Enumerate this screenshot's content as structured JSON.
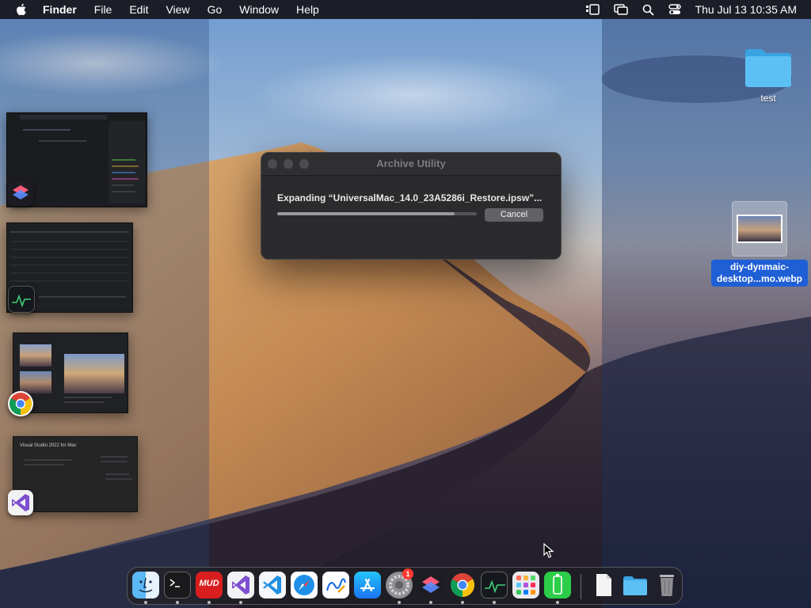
{
  "menubar": {
    "app_name": "Finder",
    "items": [
      "File",
      "Edit",
      "View",
      "Go",
      "Window",
      "Help"
    ],
    "clock": "Thu Jul 13  10:35 AM"
  },
  "dialog": {
    "title": "Archive Utility",
    "message": "Expanding “UniversalMac_14.0_23A5286i_Restore.ipsw”...",
    "progress_percent": 89,
    "cancel_label": "Cancel"
  },
  "desktop": {
    "folder_label": "test",
    "file_label_line1": "diy-dynmaic-",
    "file_label_line2": "desktop...mo.webp"
  },
  "stage_manager": {
    "apps": [
      "shortcuts-icon",
      "activity-monitor-icon",
      "chrome-icon",
      "visual-studio-icon"
    ],
    "vs_thumb_title": "Visual Studio 2022 for Mac"
  },
  "dock": {
    "apps": [
      "finder-icon",
      "terminal-icon",
      "mud-icon",
      "visual-studio-icon",
      "vscode-icon",
      "safari-icon",
      "freeform-icon",
      "app-store-icon",
      "system-settings-icon",
      "shortcuts-icon",
      "chrome-icon",
      "activity-monitor-icon",
      "launchpad-icon",
      "battery-app-icon",
      "document-icon",
      "downloads-folder-icon",
      "trash-icon"
    ],
    "mud_label": "MUD",
    "settings_badge": "1"
  },
  "colors": {
    "menubar_bg": "#141418",
    "dialog_bg": "#2b2b2d",
    "selection_blue": "#1f5fd6"
  }
}
